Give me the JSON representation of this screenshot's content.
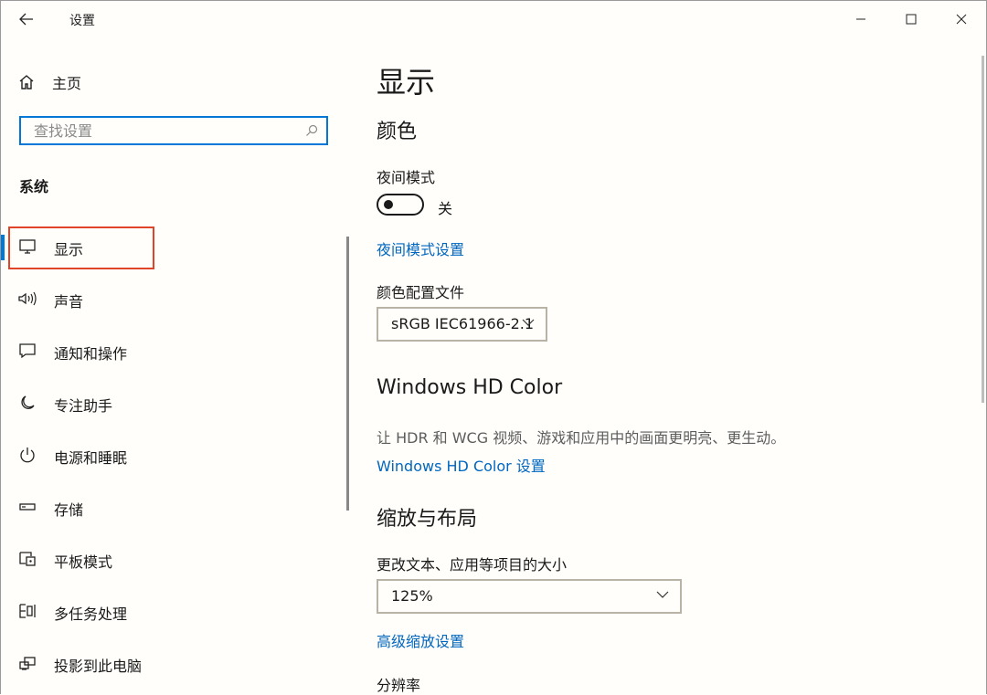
{
  "window": {
    "title": "设置"
  },
  "sidebar": {
    "home_label": "主页",
    "search_placeholder": "查找设置",
    "section_label": "系统",
    "items": [
      {
        "label": "显示",
        "icon": "monitor-icon",
        "selected": true
      },
      {
        "label": "声音",
        "icon": "speaker-icon"
      },
      {
        "label": "通知和操作",
        "icon": "notification-icon"
      },
      {
        "label": "专注助手",
        "icon": "moon-icon"
      },
      {
        "label": "电源和睡眠",
        "icon": "power-icon"
      },
      {
        "label": "存储",
        "icon": "storage-icon"
      },
      {
        "label": "平板模式",
        "icon": "tablet-mode-icon"
      },
      {
        "label": "多任务处理",
        "icon": "multitask-icon"
      },
      {
        "label": "投影到此电脑",
        "icon": "project-icon"
      }
    ]
  },
  "main": {
    "page_title": "显示",
    "color_heading": "颜色",
    "night_light_label": "夜间模式",
    "night_light_state": "关",
    "night_light_on": false,
    "night_light_settings_link": "夜间模式设置",
    "color_profile_label": "颜色配置文件",
    "color_profile_value": "sRGB IEC61966-2.1",
    "hd_color_heading": "Windows HD Color",
    "hd_color_desc": "让 HDR 和 WCG 视频、游戏和应用中的画面更明亮、更生动。",
    "hd_color_link": "Windows HD Color 设置",
    "scale_heading": "缩放与布局",
    "scale_label": "更改文本、应用等项目的大小",
    "scale_value": "125%",
    "advanced_scale_link": "高级缩放设置",
    "resolution_label": "分辨率"
  },
  "colors": {
    "accent": "#0078d7",
    "link": "#0067c0",
    "highlight_frame": "#e0452a"
  }
}
